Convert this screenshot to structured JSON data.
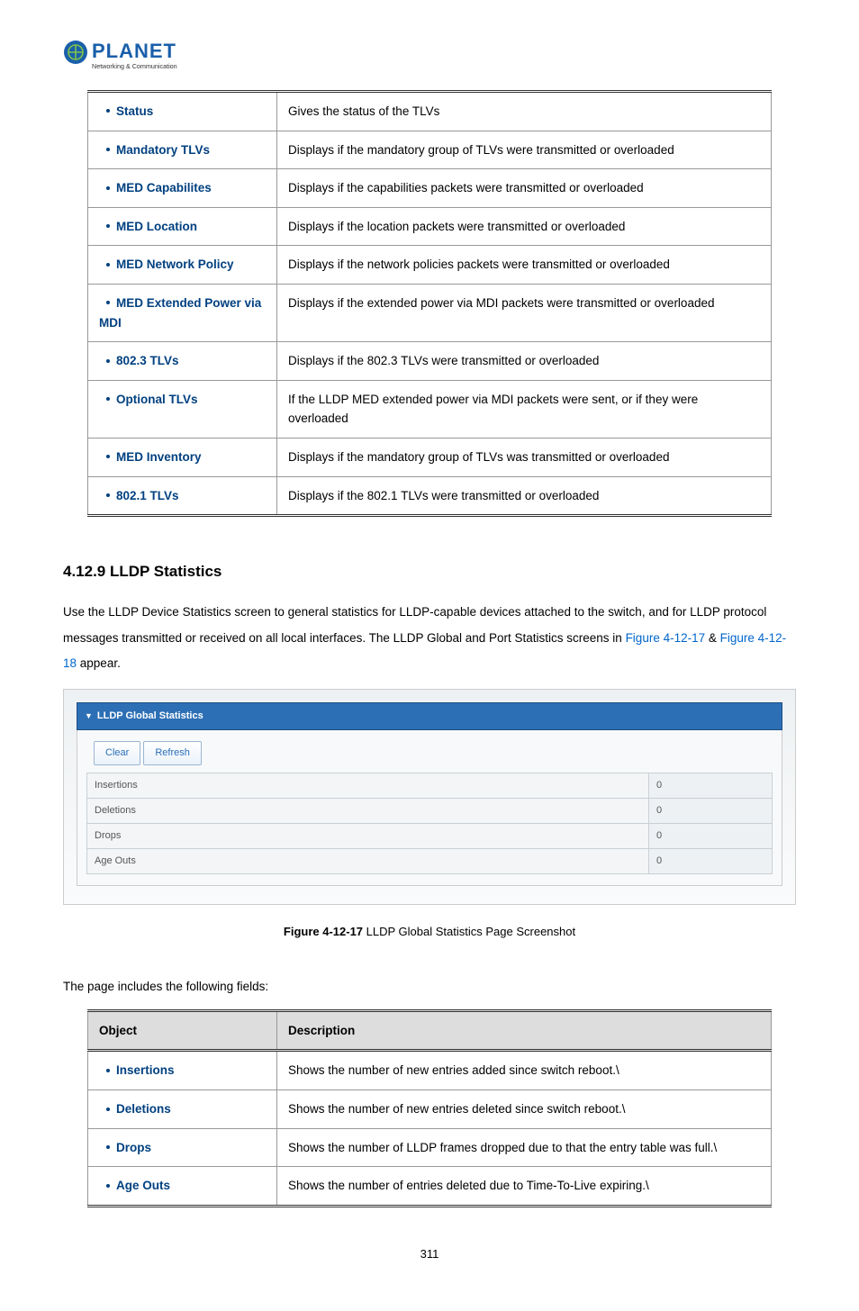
{
  "logo": {
    "brand": "PLANET",
    "tagline": "Networking & Communication"
  },
  "table1": {
    "rows": [
      {
        "term": "Status",
        "desc": "Gives the status of the TLVs"
      },
      {
        "term": "Mandatory TLVs",
        "desc": "Displays if the mandatory group of TLVs were transmitted or overloaded"
      },
      {
        "term": "MED Capabilites",
        "desc": "Displays if the capabilities packets were transmitted or overloaded"
      },
      {
        "term": "MED Location",
        "desc": "Displays if the location packets were transmitted or overloaded"
      },
      {
        "term": "MED Network Policy",
        "desc": "Displays if the network policies packets were transmitted or overloaded"
      },
      {
        "term": "MED Extended Power via MDI",
        "desc": "Displays if the extended power via MDI packets were transmitted or overloaded"
      },
      {
        "term": "802.3 TLVs",
        "desc": "Displays if the 802.3 TLVs were transmitted or overloaded"
      },
      {
        "term": "Optional TLVs",
        "desc": "If the LLDP MED extended power via MDI packets were sent, or if they were overloaded"
      },
      {
        "term": "MED Inventory",
        "desc": "Displays if the mandatory group of TLVs was transmitted or overloaded"
      },
      {
        "term": "802.1 TLVs",
        "desc": "Displays if the 802.1 TLVs were transmitted or overloaded"
      }
    ]
  },
  "section": {
    "title": "4.12.9 LLDP Statistics",
    "intro_a": "Use the LLDP Device Statistics screen to general statistics for LLDP-capable devices attached to the switch, and for LLDP protocol messages transmitted or received on all local interfaces. The LLDP Global and Port Statistics screens in ",
    "figlink1": "Figure 4-12-17",
    "intro_b": " & ",
    "figlink2": "Figure 4-12-18",
    "intro_c": " appear."
  },
  "panel": {
    "title": "LLDP Global Statistics",
    "buttons": {
      "clear": "Clear",
      "refresh": "Refresh"
    },
    "rows": [
      {
        "label": "Insertions",
        "value": "0"
      },
      {
        "label": "Deletions",
        "value": "0"
      },
      {
        "label": "Drops",
        "value": "0"
      },
      {
        "label": "Age Outs",
        "value": "0"
      }
    ]
  },
  "caption": {
    "bold": "Figure 4-12-17",
    "rest": " LLDP Global Statistics Page Screenshot"
  },
  "fields_intro": "The page includes the following fields:",
  "table2": {
    "head": {
      "object": "Object",
      "description": "Description"
    },
    "rows": [
      {
        "term": "Insertions",
        "desc": "Shows the number of new entries added since switch reboot.\\"
      },
      {
        "term": "Deletions",
        "desc": "Shows the number of new entries deleted since switch reboot.\\"
      },
      {
        "term": "Drops",
        "desc": "Shows the number of LLDP frames dropped due to that the entry table was full.\\"
      },
      {
        "term": "Age Outs",
        "desc": "Shows the number of entries deleted due to Time-To-Live expiring.\\"
      }
    ]
  },
  "page_number": "311"
}
